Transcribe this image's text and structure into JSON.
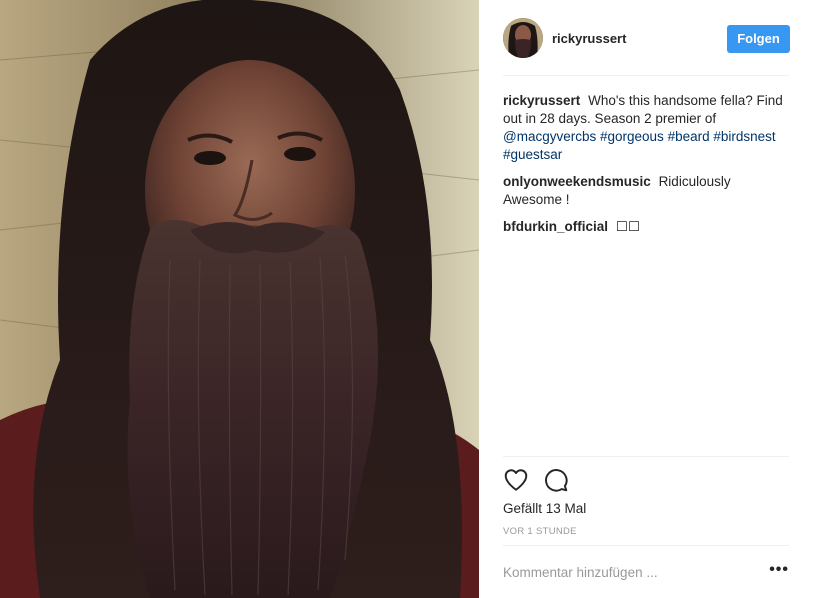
{
  "post": {
    "author": "rickyrussert",
    "follow_label": "Folgen",
    "comments": [
      {
        "author": "rickyrussert",
        "text": "Who's this handsome fella? Find out in 28 days. Season 2 premier of ",
        "links": [
          "@macgyvercbs",
          "#gorgeous",
          "#beard",
          "#birdsnest",
          "#guestsar"
        ]
      },
      {
        "author": "onlyonweekendsmusic",
        "text": "Ridiculously Awesome !"
      },
      {
        "author": "bfdurkin_official",
        "text": "☐☐"
      }
    ],
    "likes_label": "Gefällt 13 Mal",
    "time_label": "VOR 1 STUNDE",
    "comment_placeholder": "Kommentar hinzufügen ...",
    "more_label": "•••",
    "icons": {
      "like": "heart-icon",
      "comment": "comment-bubble-icon",
      "more": "more-options-icon"
    },
    "colors": {
      "follow": "#3897f0",
      "link": "#003569",
      "muted": "#999999",
      "text": "#262626"
    }
  }
}
